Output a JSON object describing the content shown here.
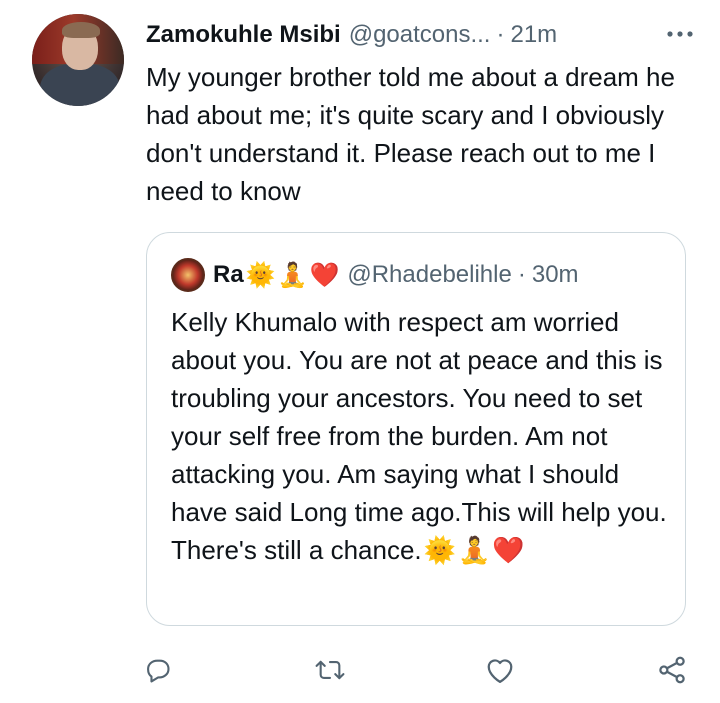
{
  "tweet": {
    "author_name": "Zamokuhle Msibi",
    "author_handle": "@goatcons...",
    "separator": "·",
    "time": "21m",
    "more_label": "•••",
    "text": "My younger brother told me about a dream he had about me; it's quite scary and I obviously don't understand it. Please reach out to me I need to know"
  },
  "quote": {
    "author_name": "Ra",
    "author_emojis": [
      "🌞",
      "🧘",
      "❤️"
    ],
    "author_handle": "@Rhadebelihle",
    "separator": "·",
    "time": "30m",
    "text": "Kelly Khumalo with respect am worried about you. You are not at peace and this is troubling your ancestors. You need to set your self free from the burden. Am not attacking you. Am saying what I should have said Long time ago.This will help you. There's still a chance.",
    "trailing_emojis": [
      "🌞",
      "🧘",
      "❤️"
    ]
  },
  "actions": [
    {
      "name": "reply",
      "icon": "reply-icon"
    },
    {
      "name": "retweet",
      "icon": "retweet-icon"
    },
    {
      "name": "like",
      "icon": "heart-icon"
    },
    {
      "name": "share",
      "icon": "share-icon"
    }
  ],
  "colors": {
    "text": "#0f1419",
    "secondary": "#536471",
    "border": "#cfd9de",
    "heart": "#e0245e"
  }
}
